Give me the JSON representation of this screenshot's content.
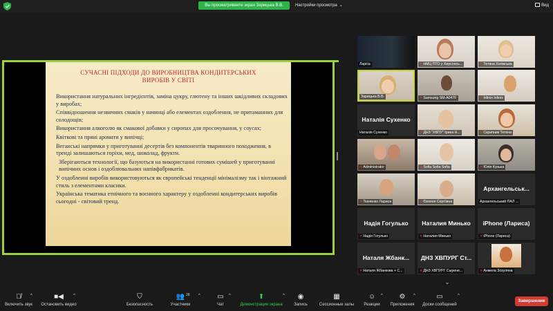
{
  "topbar": {
    "sharing_banner": "Вы просматриваете экран Зарицька В.В.",
    "view_options": "Настройки просмотра",
    "view_button": "Вид",
    "colors": {
      "banner": "#2fb34a",
      "shield": "#2fb34a"
    }
  },
  "slide": {
    "title_line1": "СУЧАСНІ ПІДХОДИ ДО ВИРОБНИЦТВА КОНДИТЕРСЬКИХ",
    "title_line2": "ВИРОБІВ У СВІТІ",
    "paragraphs": [
      "Використання натуральних інгредієнтів, заміна цукру, глютену та інших шкідливих складових у виробах;",
      "Співвідношення незвичних смаків у начинці або елементах оздоблення, не притаманних для солодощів;",
      "Використання алкоголю як смакової добавки у сиропах для просочування, у соусах;",
      "Квіткові та пряні аромати у випічці;",
      "Веганські напрямки у приготуванні десертів без компонентів тваринного походження, в тренді залишаються горіхи, мед, шоколад, фрукти.",
      "Зберігаються технології, що базуються на використанні готових сумішей у приготуванні випічних основ і оздоблювальних напівфабрикатів.",
      "У оздобленні виробів використовуються як європейські тенденції мінімалізму так і вінтажний стиль з елементами класики.",
      "Українська тематика етнічного та воєнного характеру у оздобленні кондитерських виробів сьогодні - світовий тренд."
    ],
    "colors": {
      "title": "#c0282d",
      "text": "#1e2a4a",
      "frame": "#9bd13d"
    }
  },
  "gallery": {
    "tiles": [
      {
        "name": "Ларіса",
        "big": "",
        "muted": false
      },
      {
        "name": "НМЦ ПТО у Херсонсь...",
        "big": "",
        "muted": true
      },
      {
        "name": "Тетяна Холмська",
        "big": "",
        "muted": true
      },
      {
        "name": "Зарицька В.В.",
        "big": "",
        "muted": false
      },
      {
        "name": "Samsung SM-A047F",
        "big": "",
        "muted": true
      },
      {
        "name": "Infinix Infinix",
        "big": "",
        "muted": true
      },
      {
        "name": "Наталія Сухенко",
        "big": "Наталія Сухенко",
        "muted": false
      },
      {
        "name": "ДНЗ \"ХВПУ\" Ірина Н...",
        "big": "",
        "muted": true
      },
      {
        "name": "Скрипник Тетяна",
        "big": "",
        "muted": true
      },
      {
        "name": "Administrator",
        "big": "",
        "muted": true
      },
      {
        "name": "Sofia Sofia Sofia",
        "big": "",
        "muted": true
      },
      {
        "name": "Юлія Кунька",
        "big": "",
        "muted": true
      },
      {
        "name": "Ткаченко Лариса",
        "big": "",
        "muted": true
      },
      {
        "name": "Євгенія Сергіївна",
        "big": "",
        "muted": true
      },
      {
        "name": "Архангельський ПАЛ ...",
        "big": "Архангельськ...",
        "muted": false
      },
      {
        "name": "Надія Гогулько",
        "big": "Надія Гогулько",
        "muted": true
      },
      {
        "name": "Наталия Минько",
        "big": "Наталия Минько",
        "muted": true
      },
      {
        "name": "iPhone (Лариса)",
        "big": "iPhone (Лариса)",
        "muted": true
      },
      {
        "name": "Наталя Жбанкова + С...",
        "big": "Наталя Жбанк...",
        "muted": true
      },
      {
        "name": "ДНЗ ХВПУРГ Сырене...",
        "big": "ДНЗ ХВПУРГ Ст...",
        "muted": true
      },
      {
        "name": "Анжела Зозуляна",
        "big": "",
        "muted": true
      }
    ],
    "more_label": "⌄"
  },
  "toolbar": {
    "unmute": "Включить звук",
    "video": "Остановить видео",
    "security": "Безопасность",
    "participants": "Участники",
    "participants_count": "28",
    "chat": "Чат",
    "share": "Демонстрация экрана",
    "record": "Запись",
    "rooms": "Сессионные залы",
    "reactions": "Реакции",
    "apps": "Приложения",
    "whiteboard": "Доски сообщений",
    "end": "Завершение",
    "colors": {
      "share": "#2fd158",
      "end": "#d13b34"
    }
  }
}
